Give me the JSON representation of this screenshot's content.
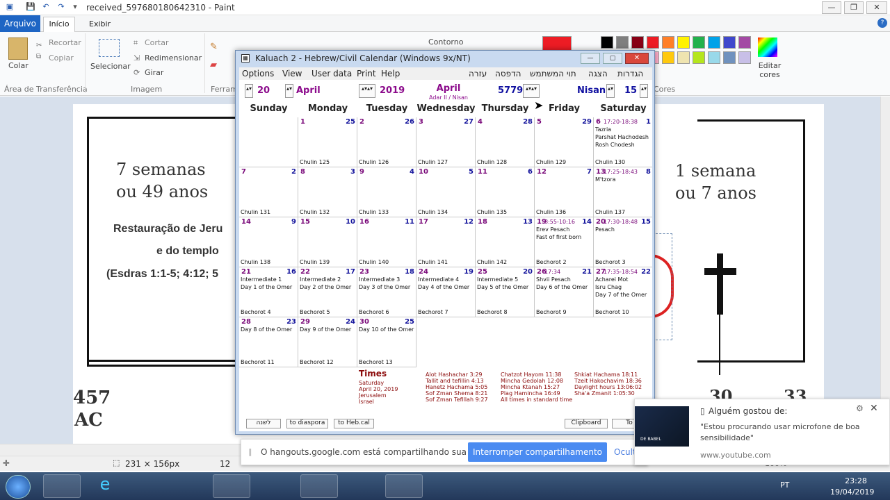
{
  "paint": {
    "title": "received_597680180642310 - Paint",
    "tab_file": "Arquivo",
    "tab_home": "Início",
    "tab_view": "Exibir",
    "clipboard": {
      "paste": "Colar",
      "cut": "Recortar",
      "copy": "Copiar",
      "group": "Área de Transferência"
    },
    "image": {
      "select": "Selecionar",
      "crop": "Cortar",
      "resize": "Redimensionar",
      "rotate": "Girar",
      "group": "Imagem"
    },
    "tools_group": "Ferram",
    "outline": "Contorno",
    "colors_group": "Cores",
    "edit_colors": "Editar cores",
    "palette": [
      "#000000",
      "#7f7f7f",
      "#880015",
      "#ed1c24",
      "#ff7f27",
      "#fff200",
      "#22b14c",
      "#00a2e8",
      "#3f48cc",
      "#a349a4",
      "#ffffff",
      "#c3c3c3",
      "#b97a57",
      "#ffaec9",
      "#ffc90e",
      "#efe4b0",
      "#b5e61d",
      "#99d9ea",
      "#7092be",
      "#c8bfe7"
    ],
    "status": {
      "selection": "231 × 156px",
      "size": "12",
      "zoom": "100%"
    }
  },
  "figure": {
    "left_line1": "7 semanas",
    "left_line2": "ou 49 anos",
    "left_text1": "Restauração de Jeru",
    "left_text2": "e do templo",
    "left_text3": "(Esdras 1:1-5; 4:12; 5",
    "left_year": "457",
    "left_era": "AC",
    "right_line1": "1 semana",
    "right_line2": "ou 7 anos",
    "right_num1": "30",
    "right_num2": "33"
  },
  "kaluach": {
    "title": "Kaluach 2 - Hebrew/Civil Calendar (Windows 9x/NT)",
    "menu": [
      "Options",
      "View",
      "User data",
      "Print",
      "Help"
    ],
    "menu_heb": [
      "הגדרות",
      "הצגה",
      "תוי המשתמש",
      "הדפסה",
      "עזרה"
    ],
    "ctrl": {
      "day": "20",
      "month": "April",
      "year": "2019",
      "center_month": "April",
      "center_sub": "Adar II / Nisan",
      "heb_year": "5779",
      "heb_month": "Nisan",
      "heb_day": "15"
    },
    "weekdays": [
      "Sunday",
      "Monday",
      "Tuesday",
      "Wednesday",
      "Thursday",
      "Friday",
      "Saturday"
    ],
    "cells": [
      {
        "row": 0,
        "col": 1,
        "civil": "1",
        "heb": "25",
        "foot": "Chulin 125"
      },
      {
        "row": 0,
        "col": 2,
        "civil": "2",
        "heb": "26",
        "foot": "Chulin 126"
      },
      {
        "row": 0,
        "col": 3,
        "civil": "3",
        "heb": "27",
        "foot": "Chulin 127"
      },
      {
        "row": 0,
        "col": 4,
        "civil": "4",
        "heb": "28",
        "foot": "Chulin 128"
      },
      {
        "row": 0,
        "col": 5,
        "civil": "5",
        "heb": "29",
        "foot": "Chulin 129"
      },
      {
        "row": 0,
        "col": 6,
        "civil": "6",
        "time": "17:20-18:38",
        "heb": "1",
        "events": "Tazria\nParshat Hachodesh\nRosh Chodesh",
        "foot": "Chulin 130"
      },
      {
        "row": 1,
        "col": 0,
        "civil": "7",
        "heb": "2",
        "foot": "Chulin 131"
      },
      {
        "row": 1,
        "col": 1,
        "civil": "8",
        "heb": "3",
        "foot": "Chulin 132"
      },
      {
        "row": 1,
        "col": 2,
        "civil": "9",
        "heb": "4",
        "foot": "Chulin 133"
      },
      {
        "row": 1,
        "col": 3,
        "civil": "10",
        "heb": "5",
        "foot": "Chulin 134"
      },
      {
        "row": 1,
        "col": 4,
        "civil": "11",
        "heb": "6",
        "foot": "Chulin 135"
      },
      {
        "row": 1,
        "col": 5,
        "civil": "12",
        "heb": "7",
        "foot": "Chulin 136"
      },
      {
        "row": 1,
        "col": 6,
        "civil": "13",
        "time": "17:25-18:43",
        "heb": "8",
        "events": "M'tzora",
        "foot": "Chulin 137"
      },
      {
        "row": 2,
        "col": 0,
        "civil": "14",
        "heb": "9",
        "foot": "Chulin 138"
      },
      {
        "row": 2,
        "col": 1,
        "civil": "15",
        "heb": "10",
        "foot": "Chulin 139"
      },
      {
        "row": 2,
        "col": 2,
        "civil": "16",
        "heb": "11",
        "foot": "Chulin 140"
      },
      {
        "row": 2,
        "col": 3,
        "civil": "17",
        "heb": "12",
        "foot": "Chulin 141"
      },
      {
        "row": 2,
        "col": 4,
        "civil": "18",
        "heb": "13",
        "foot": "Chulin 142"
      },
      {
        "row": 2,
        "col": 5,
        "civil": "19",
        "time": "8:55-10:16",
        "heb": "14",
        "events": "Erev Pesach\nFast of first born",
        "foot": "Bechorot 2"
      },
      {
        "row": 2,
        "col": 6,
        "civil": "20",
        "time": "17:30-18:48",
        "heb": "15",
        "events": "Pesach",
        "foot": "Bechorot 3"
      },
      {
        "row": 3,
        "col": 0,
        "civil": "21",
        "heb": "16",
        "events": "Intermediate 1\nDay 1 of the Omer",
        "foot": "Bechorot 4"
      },
      {
        "row": 3,
        "col": 1,
        "civil": "22",
        "heb": "17",
        "events": "Intermediate 2\nDay 2 of the Omer",
        "foot": "Bechorot 5"
      },
      {
        "row": 3,
        "col": 2,
        "civil": "23",
        "heb": "18",
        "events": "Intermediate 3\nDay 3 of the Omer",
        "foot": "Bechorot 6"
      },
      {
        "row": 3,
        "col": 3,
        "civil": "24",
        "heb": "19",
        "events": "Intermediate 4\nDay 4 of the Omer",
        "foot": "Bechorot 7"
      },
      {
        "row": 3,
        "col": 4,
        "civil": "25",
        "heb": "20",
        "events": "Intermediate 5\nDay 5 of the Omer",
        "foot": "Bechorot 8"
      },
      {
        "row": 3,
        "col": 5,
        "civil": "26",
        "time": "17:34",
        "heb": "21",
        "events": "Shvii Pesach\nDay 6 of the Omer",
        "foot": "Bechorot 9"
      },
      {
        "row": 3,
        "col": 6,
        "civil": "27",
        "time": "17:35-18:54",
        "heb": "22",
        "events": "Acharei Mot\nIsru Chag\nDay 7 of the Omer",
        "foot": "Bechorot 10"
      },
      {
        "row": 4,
        "col": 0,
        "civil": "28",
        "heb": "23",
        "events": "Day 8 of the Omer",
        "foot": "Bechorot 11"
      },
      {
        "row": 4,
        "col": 1,
        "civil": "29",
        "heb": "24",
        "events": "Day 9 of the Omer",
        "foot": "Bechorot 12"
      },
      {
        "row": 4,
        "col": 2,
        "civil": "30",
        "heb": "25",
        "events": "Day 10 of the Omer",
        "foot": "Bechorot 13"
      }
    ],
    "times": {
      "header": "Times",
      "info": [
        "Saturday",
        "April 20, 2019",
        "Jerusalem",
        "Israel"
      ],
      "col1": [
        "Alot Hashachar  3:29",
        "Tallit and tefillin  4:13",
        "Hanetz Hachama  5:05",
        "Sof Zman Shema  8:21",
        "Sof Zman Tefillah  9:27"
      ],
      "col2": [
        "Chatzot Hayom  11:38",
        "Mincha Gedolah  12:08",
        "Mincha Ktanah  15:27",
        "Plag Hamincha  16:49",
        "All times in standard time"
      ],
      "col3": [
        "Shkiat Hachama  18:11",
        "Tzeit Hakochavim  18:36",
        "Daylight hours  13:06:02",
        "Sha'a Zmanit  1:05:30"
      ]
    },
    "bottom_buttons": [
      "לשנה",
      "to diaspora",
      "to Heb.cal",
      "Clipboard",
      "To"
    ]
  },
  "hangouts": {
    "message": "O hangouts.google.com está compartilhando sua tela.",
    "stop": "Interromper compartilhamento",
    "hide": "Ocultar"
  },
  "notification": {
    "title": "Alguém gostou de:",
    "body": "\"Estou procurando usar microfone de boa sensibilidade\"",
    "source": "www.youtube.com",
    "thumb_text": "DE BABEL"
  },
  "taskbar": {
    "lang": "PT",
    "time": "23:28",
    "date": "19/04/2019"
  }
}
